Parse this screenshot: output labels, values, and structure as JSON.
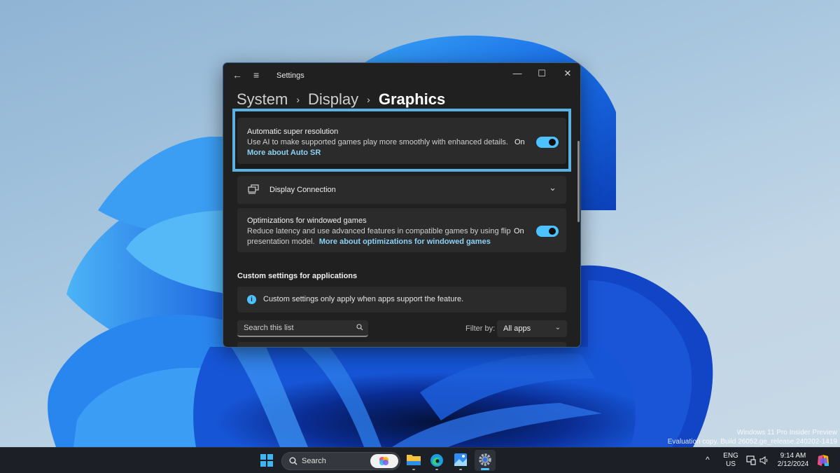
{
  "window": {
    "title": "Settings",
    "controls": {
      "minimize": "—",
      "maximize": "☐",
      "close": "✕"
    },
    "back_glyph": "←",
    "menu_glyph": "≡"
  },
  "breadcrumb": {
    "items": [
      "System",
      "Display"
    ],
    "current": "Graphics",
    "separator": "›"
  },
  "auto_sr": {
    "title": "Automatic super resolution",
    "description": "Use AI to make supported games play more smoothly with enhanced details.",
    "link": "More about Auto SR",
    "toggle_label": "On",
    "toggle_on": true
  },
  "display_connection": {
    "title": "Display Connection",
    "icon": "display-connection-icon",
    "chevron": "⌄"
  },
  "windowed_games": {
    "title": "Optimizations for windowed games",
    "description_line1": "Reduce latency and use advanced features in compatible games by using flip",
    "description_line2": "presentation model.",
    "link": "More about optimizations for windowed games",
    "toggle_label": "On",
    "toggle_on": true
  },
  "custom_settings": {
    "section_title": "Custom settings for applications",
    "info_text": "Custom settings only apply when apps support the feature.",
    "info_glyph": "i",
    "search_placeholder": "Search this list",
    "filter_label": "Filter by:",
    "filter_value": "All apps",
    "filter_chevron": "⌄"
  },
  "watermark": {
    "line1": "Windows 11 Pro Insider Preview",
    "line2": "Evaluation copy. Build 26052.ge_release.240202-1419"
  },
  "taskbar": {
    "search_label": "Search",
    "apps": [
      "File Explorer",
      "Microsoft Edge",
      "Photos",
      "Settings"
    ],
    "active_app": "Settings",
    "tray": {
      "chevron": "^",
      "lang_line1": "ENG",
      "lang_line2": "US",
      "time": "9:14 AM",
      "date": "2/12/2024"
    }
  },
  "colors": {
    "accent": "#4cc2ff",
    "link": "#8cd1f5",
    "highlight_border": "#5ab1e4",
    "window_bg": "#202020",
    "card_bg": "#2b2b2b"
  }
}
